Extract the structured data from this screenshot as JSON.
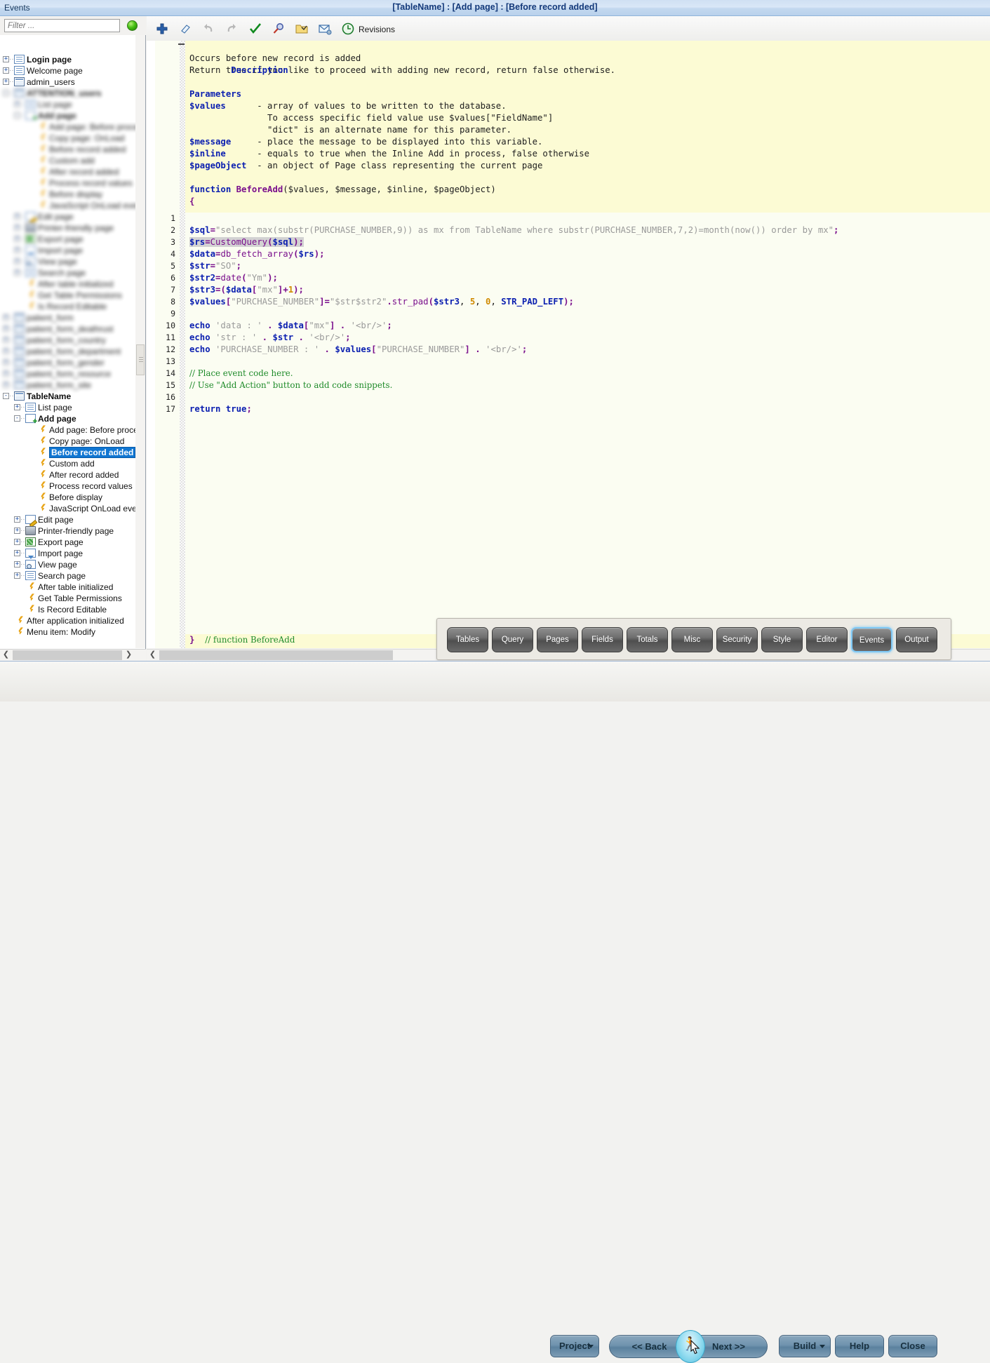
{
  "titlebar": {
    "left_label": "Events",
    "center_title": "[TableName] : [Add page] : [Before record added]"
  },
  "sidebar": {
    "filter_placeholder": "Filter ...",
    "filter_value": "",
    "status_icon": "green-status-dot",
    "tree": [
      {
        "label": "Login page",
        "indent": 0,
        "icon": "page-icon",
        "expander": "+",
        "bold": true,
        "blurred": false
      },
      {
        "label": "Welcome page",
        "indent": 0,
        "icon": "page-icon",
        "expander": "+",
        "bold": false,
        "blurred": false
      },
      {
        "label": "admin_users",
        "indent": 0,
        "icon": "table-icon",
        "expander": "+",
        "bold": false,
        "blurred": false
      },
      {
        "label": "ATTENTION_users",
        "indent": 0,
        "icon": "table-icon",
        "expander": "-",
        "bold": true,
        "blurred": true
      },
      {
        "label": "List page",
        "indent": 1,
        "icon": "page-icon",
        "expander": "+",
        "bold": false,
        "blurred": true
      },
      {
        "label": "Add page",
        "indent": 1,
        "icon": "addpage-icon",
        "expander": "-",
        "bold": true,
        "blurred": true
      },
      {
        "label": "Add page: Before process",
        "indent": 2,
        "icon": "bolt-icon",
        "expander": "",
        "bold": false,
        "blurred": true
      },
      {
        "label": "Copy page: OnLoad",
        "indent": 2,
        "icon": "bolt-icon",
        "expander": "",
        "bold": false,
        "blurred": true
      },
      {
        "label": "Before record added",
        "indent": 2,
        "icon": "bolt-icon",
        "expander": "",
        "bold": false,
        "blurred": true
      },
      {
        "label": "Custom add",
        "indent": 2,
        "icon": "bolt-icon",
        "expander": "",
        "bold": false,
        "blurred": true
      },
      {
        "label": "After record added",
        "indent": 2,
        "icon": "bolt-icon",
        "expander": "",
        "bold": false,
        "blurred": true
      },
      {
        "label": "Process record values",
        "indent": 2,
        "icon": "bolt-icon",
        "expander": "",
        "bold": false,
        "blurred": true
      },
      {
        "label": "Before display",
        "indent": 2,
        "icon": "bolt-icon",
        "expander": "",
        "bold": false,
        "blurred": true
      },
      {
        "label": "JavaScript OnLoad event",
        "indent": 2,
        "icon": "bolt-icon",
        "expander": "",
        "bold": false,
        "blurred": true
      },
      {
        "label": "Edit page",
        "indent": 1,
        "icon": "edit-icon",
        "expander": "+",
        "bold": false,
        "blurred": true
      },
      {
        "label": "Printer-friendly page",
        "indent": 1,
        "icon": "print-icon",
        "expander": "+",
        "bold": false,
        "blurred": true
      },
      {
        "label": "Export page",
        "indent": 1,
        "icon": "export-icon",
        "expander": "+",
        "bold": false,
        "blurred": true
      },
      {
        "label": "Import page",
        "indent": 1,
        "icon": "import-icon",
        "expander": "+",
        "bold": false,
        "blurred": true
      },
      {
        "label": "View page",
        "indent": 1,
        "icon": "view-icon",
        "expander": "+",
        "bold": false,
        "blurred": true
      },
      {
        "label": "Search page",
        "indent": 1,
        "icon": "page-icon",
        "expander": "+",
        "bold": false,
        "blurred": true
      },
      {
        "label": "After table initialized",
        "indent": 1,
        "icon": "bolt-icon",
        "expander": "",
        "bold": false,
        "blurred": true
      },
      {
        "label": "Get Table Permissions",
        "indent": 1,
        "icon": "bolt-icon",
        "expander": "",
        "bold": false,
        "blurred": true
      },
      {
        "label": "Is Record Editable",
        "indent": 1,
        "icon": "bolt-icon",
        "expander": "",
        "bold": false,
        "blurred": true
      },
      {
        "label": "patient_form",
        "indent": 0,
        "icon": "table-icon",
        "expander": "+",
        "bold": false,
        "blurred": true
      },
      {
        "label": "patient_form_deathrust",
        "indent": 0,
        "icon": "table-icon",
        "expander": "+",
        "bold": false,
        "blurred": true
      },
      {
        "label": "patient_form_country",
        "indent": 0,
        "icon": "table-icon",
        "expander": "+",
        "bold": false,
        "blurred": true
      },
      {
        "label": "patient_form_department",
        "indent": 0,
        "icon": "table-icon",
        "expander": "+",
        "bold": false,
        "blurred": true
      },
      {
        "label": "patient_form_gender",
        "indent": 0,
        "icon": "table-icon",
        "expander": "+",
        "bold": false,
        "blurred": true
      },
      {
        "label": "patient_form_resource",
        "indent": 0,
        "icon": "table-icon",
        "expander": "+",
        "bold": false,
        "blurred": true
      },
      {
        "label": "patient_form_site",
        "indent": 0,
        "icon": "table-icon",
        "expander": "+",
        "bold": false,
        "blurred": true
      },
      {
        "label": "TableName",
        "indent": 0,
        "icon": "table-icon",
        "expander": "-",
        "bold": true,
        "blurred": false
      },
      {
        "label": "List page",
        "indent": 1,
        "icon": "page-icon",
        "expander": "+",
        "bold": false,
        "blurred": false
      },
      {
        "label": "Add page",
        "indent": 1,
        "icon": "addpage-icon",
        "expander": "-",
        "bold": true,
        "blurred": false
      },
      {
        "label": "Add page: Before process",
        "indent": 2,
        "icon": "bolt-icon",
        "expander": "",
        "bold": false,
        "blurred": false
      },
      {
        "label": "Copy page: OnLoad",
        "indent": 2,
        "icon": "bolt-icon",
        "expander": "",
        "bold": false,
        "blurred": false
      },
      {
        "label": "Before record added",
        "indent": 2,
        "icon": "bolt-icon",
        "expander": "",
        "bold": true,
        "blurred": false,
        "selected": true
      },
      {
        "label": "Custom add",
        "indent": 2,
        "icon": "bolt-icon",
        "expander": "",
        "bold": false,
        "blurred": false
      },
      {
        "label": "After record added",
        "indent": 2,
        "icon": "bolt-icon",
        "expander": "",
        "bold": false,
        "blurred": false
      },
      {
        "label": "Process record values",
        "indent": 2,
        "icon": "bolt-icon",
        "expander": "",
        "bold": false,
        "blurred": false
      },
      {
        "label": "Before display",
        "indent": 2,
        "icon": "bolt-icon",
        "expander": "",
        "bold": false,
        "blurred": false
      },
      {
        "label": "JavaScript OnLoad event",
        "indent": 2,
        "icon": "bolt-icon",
        "expander": "",
        "bold": false,
        "blurred": false
      },
      {
        "label": "Edit page",
        "indent": 1,
        "icon": "edit-icon",
        "expander": "+",
        "bold": false,
        "blurred": false
      },
      {
        "label": "Printer-friendly page",
        "indent": 1,
        "icon": "print-icon",
        "expander": "+",
        "bold": false,
        "blurred": false
      },
      {
        "label": "Export page",
        "indent": 1,
        "icon": "export-icon",
        "expander": "+",
        "bold": false,
        "blurred": false
      },
      {
        "label": "Import page",
        "indent": 1,
        "icon": "import-icon",
        "expander": "+",
        "bold": false,
        "blurred": false
      },
      {
        "label": "View page",
        "indent": 1,
        "icon": "view-icon",
        "expander": "+",
        "bold": false,
        "blurred": false
      },
      {
        "label": "Search page",
        "indent": 1,
        "icon": "page-icon",
        "expander": "+",
        "bold": false,
        "blurred": false
      },
      {
        "label": "After table initialized",
        "indent": 1,
        "icon": "bolt-icon",
        "expander": "",
        "bold": false,
        "blurred": false
      },
      {
        "label": "Get Table Permissions",
        "indent": 1,
        "icon": "bolt-icon",
        "expander": "",
        "bold": false,
        "blurred": false
      },
      {
        "label": "Is Record Editable",
        "indent": 1,
        "icon": "bolt-icon",
        "expander": "",
        "bold": false,
        "blurred": false
      },
      {
        "label": "After application initialized",
        "indent": 0,
        "icon": "bolt-icon",
        "expander": "",
        "bold": false,
        "blurred": false
      },
      {
        "label": "Menu item: Modify",
        "indent": 0,
        "icon": "bolt-icon",
        "expander": "",
        "bold": false,
        "blurred": false
      }
    ]
  },
  "toolbar": {
    "buttons": [
      {
        "name": "add-icon",
        "title": "Add"
      },
      {
        "name": "eraser-icon",
        "title": "Erase"
      },
      {
        "name": "undo-icon",
        "title": "Undo"
      },
      {
        "name": "redo-icon",
        "title": "Redo"
      },
      {
        "name": "check-icon",
        "title": "Check"
      },
      {
        "name": "magnifier-icon",
        "title": "Find"
      },
      {
        "name": "folder-open-icon",
        "title": "Open"
      },
      {
        "name": "envelope-settings-icon",
        "title": "Mail settings"
      },
      {
        "name": "clock-icon",
        "title": "Revisions"
      }
    ],
    "revisions_label": "Revisions"
  },
  "editor": {
    "doc_header": "Description",
    "doc_lines": [
      "Occurs before new record is added",
      "Return true if you like to proceed with adding new record, return false otherwise.",
      "",
      "Parameters",
      "$values      - array of values to be written to the database.",
      "               To access specific field value use $values[\"FieldName\"]",
      "               \"dict\" is an alternate name for this parameter.",
      "$message     - place the message to be displayed into this variable.",
      "$inline      - equals to true when the Inline Add in process, false otherwise",
      "$pageObject  - an object of Page class representing the current page",
      "",
      "function BeforeAdd($values, $message, $inline, $pageObject)",
      "{"
    ],
    "param_names": [
      "$values",
      "$message",
      "$inline",
      "$pageObject"
    ],
    "function_signature": "function BeforeAdd($values, $message, $inline, $pageObject)",
    "code_lines": [
      {
        "n": "1",
        "text": ""
      },
      {
        "n": "2",
        "text": "$sql=\"select max(substr(PURCHASE_NUMBER,9)) as mx from TableName where substr(PURCHASE_NUMBER,7,2)=month(now()) order by mx\";"
      },
      {
        "n": "3",
        "text": "$rs=CustomQuery($sql);",
        "highlighted": true
      },
      {
        "n": "4",
        "text": "$data=db_fetch_array($rs);"
      },
      {
        "n": "5",
        "text": "$str=\"SO\";"
      },
      {
        "n": "6",
        "text": "$str2=date(\"Ym\");"
      },
      {
        "n": "7",
        "text": "$str3=($data[\"mx\"]+1);"
      },
      {
        "n": "8",
        "text": "$values[\"PURCHASE_NUMBER\"]=\"$str$str2\".str_pad($str3, 5, 0, STR_PAD_LEFT);"
      },
      {
        "n": "9",
        "text": ""
      },
      {
        "n": "10",
        "text": "echo 'data : ' . $data[\"mx\"] . '<br/>';"
      },
      {
        "n": "11",
        "text": "echo 'str : ' . $str . '<br/>';"
      },
      {
        "n": "12",
        "text": "echo 'PURCHASE_NUMBER : ' . $values[\"PURCHASE_NUMBER\"] . '<br/>';"
      },
      {
        "n": "13",
        "text": ""
      },
      {
        "n": "14",
        "text": "// Place event code here.",
        "comment": true
      },
      {
        "n": "15",
        "text": "// Use \"Add Action\" button to add code snippets.",
        "comment": true
      },
      {
        "n": "16",
        "text": ""
      },
      {
        "n": "17",
        "text": "return true;"
      }
    ],
    "closing_line": "}  // function BeforeAdd"
  },
  "tabs": {
    "items": [
      {
        "label": "Tables",
        "active": false
      },
      {
        "label": "Query",
        "active": false
      },
      {
        "label": "Pages",
        "active": false
      },
      {
        "label": "Fields",
        "active": false
      },
      {
        "label": "Totals",
        "active": false
      },
      {
        "label": "Misc",
        "active": false
      },
      {
        "label": "Security",
        "active": false
      },
      {
        "label": "Style",
        "active": false
      },
      {
        "label": "Editor",
        "active": false
      },
      {
        "label": "Events",
        "active": true
      },
      {
        "label": "Output",
        "active": false
      }
    ]
  },
  "bottombar": {
    "project_label": "Project",
    "back_label": "<< Back",
    "next_label": "Next >>",
    "build_label": "Build",
    "help_label": "Help",
    "close_label": "Close",
    "run_icon": "runner-icon"
  },
  "colors": {
    "accent_blue": "#1076d2",
    "title_text": "#13397a",
    "doc_bg": "#fcfbd4",
    "code_bg": "#fbfdf2",
    "selection_gray": "#d2d2d2",
    "comment_green": "#1f8b2a",
    "keyword_blue": "#0b1fb0",
    "function_purple": "#7a0f8c",
    "number_orange": "#d08a00",
    "string_gray": "#9a9a9a",
    "status_green": "#46c013"
  }
}
